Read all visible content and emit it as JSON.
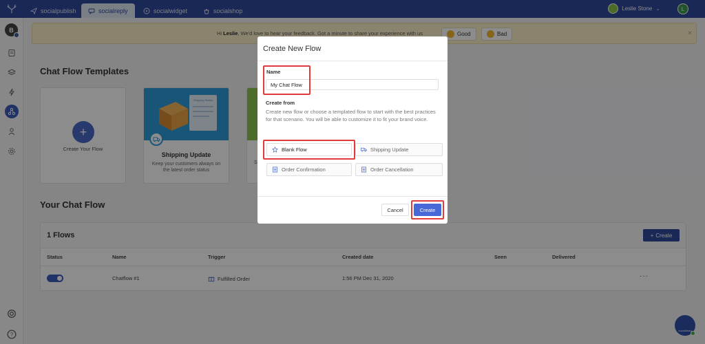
{
  "nav": {
    "tabs": [
      {
        "label": "socialpublish",
        "icon": "paper-plane-icon"
      },
      {
        "label": "socialreply",
        "icon": "chat-icon"
      },
      {
        "label": "socialwidget",
        "icon": "widget-icon"
      },
      {
        "label": "socialshop",
        "icon": "shop-bag-icon"
      }
    ],
    "active_tab": "socialreply",
    "user_name": "Leslie Stone",
    "user_initial": "L"
  },
  "rail": {
    "avatar_initial": "B"
  },
  "banner": {
    "greeting": "Hi ",
    "name": "Leslie",
    "message": ", We'd love to hear your feedback. Got a minute to share your experience with us",
    "good_label": "Good",
    "bad_label": "Bad",
    "close": "×"
  },
  "templates": {
    "title": "Chat Flow Templates",
    "create_card_label": "Create Your Flow",
    "shipping_title": "Shipping Update",
    "shipping_desc": "Keep your customers always on the latest order status",
    "shipping_card_label": "Shipping Status",
    "card3_partial": "S"
  },
  "flows": {
    "title": "Your Chat Flow",
    "count_label": "1 Flows",
    "create_label": "Create",
    "columns": [
      "Status",
      "Name",
      "Trigger",
      "Created date",
      "Seen",
      "Delivered"
    ],
    "rows": [
      {
        "enabled": true,
        "name": "Chatflow #1",
        "trigger": "Fulfilled Order",
        "created": "1:56 PM Dec 31, 2020",
        "seen": "",
        "delivered": "",
        "menu": "···"
      }
    ]
  },
  "modal": {
    "title": "Create New Flow",
    "name_label": "Name",
    "name_value": "My Chat Flow",
    "create_from_label": "Create from",
    "description": "Create new flow or choose a templated flow to start with the best practices for that scenario. You will be able to customize it to fit your brand voice.",
    "options": [
      {
        "label": "Blank Flow",
        "icon": "star-icon",
        "selected": true
      },
      {
        "label": "Shipping Update",
        "icon": "truck-icon",
        "selected": false
      },
      {
        "label": "Order Confirmation",
        "icon": "list-icon",
        "selected": false
      },
      {
        "label": "Order Cancellation",
        "icon": "list-icon",
        "selected": false
      }
    ],
    "cancel_label": "Cancel",
    "create_label": "Create"
  },
  "widget": {
    "label": "socialhead"
  },
  "colors": {
    "brand": "#2f4a9c",
    "accent": "#4868d8",
    "highlight": "#e03a3a"
  }
}
